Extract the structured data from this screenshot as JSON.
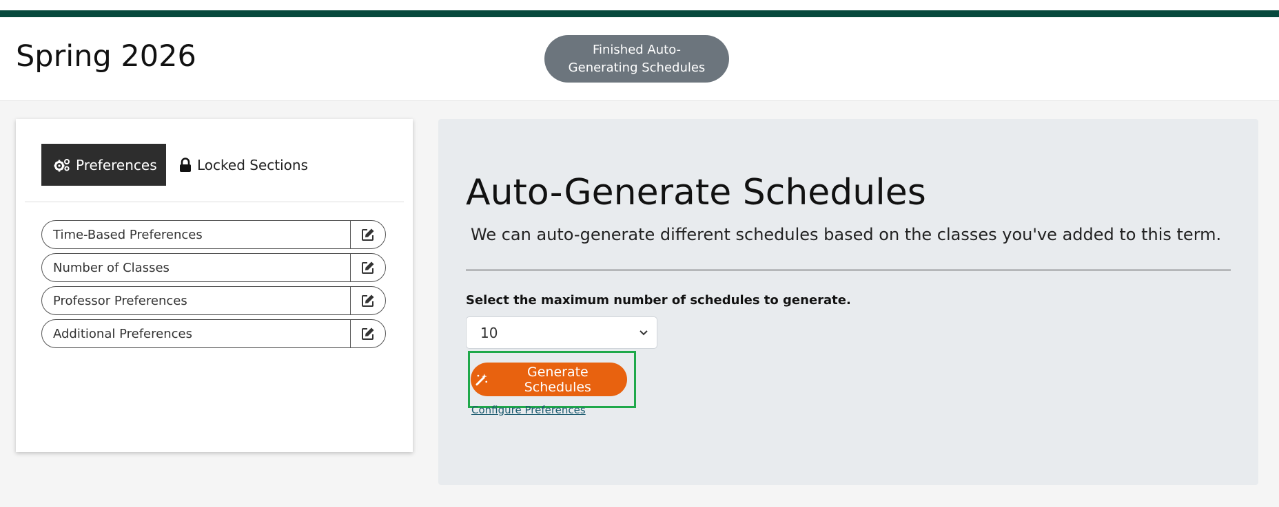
{
  "header": {
    "term": "Spring 2026",
    "status": "Finished Auto-Generating Schedules"
  },
  "sidebar": {
    "tabs": [
      {
        "label": "Preferences",
        "icon": "gears-icon"
      },
      {
        "label": "Locked Sections",
        "icon": "lock-icon"
      }
    ],
    "preferences": [
      {
        "label": "Time-Based Preferences"
      },
      {
        "label": "Number of Classes"
      },
      {
        "label": "Professor Preferences"
      },
      {
        "label": "Additional Preferences"
      }
    ]
  },
  "main": {
    "title": "Auto-Generate Schedules",
    "description": "We can auto-generate different schedules based on the classes you've added to this term.",
    "select_label": "Select the maximum number of schedules to generate.",
    "selected_count": "10",
    "generate_label": "Generate Schedules",
    "configure_link": "Configure Preferences"
  },
  "colors": {
    "brand_dark": "#07493d",
    "accent_orange": "#e8620f",
    "highlight_green": "#1fa84a",
    "status_gray": "#6c757d"
  }
}
